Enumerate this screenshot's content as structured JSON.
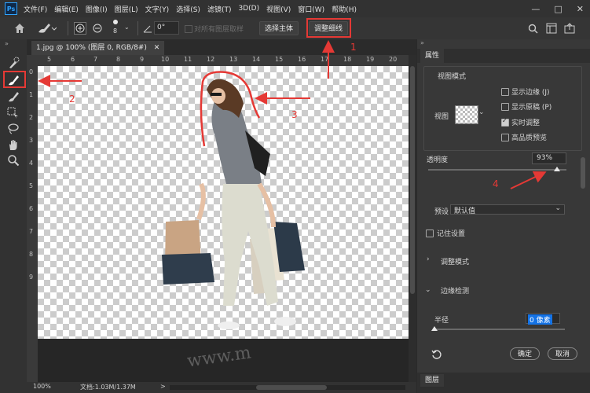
{
  "app": {
    "logo_text": "Ps"
  },
  "menu": [
    "文件(F)",
    "编辑(E)",
    "图像(I)",
    "图层(L)",
    "文字(Y)",
    "选择(S)",
    "滤镜(T)",
    "3D(D)",
    "视图(V)",
    "窗口(W)",
    "帮助(H)"
  ],
  "window_controls": {
    "minimize": "—",
    "maximize": "□",
    "close": "✕"
  },
  "options": {
    "brush_size": "8",
    "angle": "0°",
    "sample_all_layers": "对所有图层取样",
    "select_subject": "选择主体",
    "refine_edge": "调整细线"
  },
  "document": {
    "tab_title": "1.jpg @ 100% (图层 0, RGB/8#)",
    "ruler_top": [
      "5",
      "6",
      "7",
      "8",
      "9",
      "10",
      "11",
      "12",
      "13",
      "14",
      "15",
      "16",
      "17",
      "18",
      "19",
      "20"
    ],
    "ruler_left": [
      "0",
      "1",
      "2",
      "3",
      "4",
      "5",
      "6",
      "7",
      "8",
      "9"
    ],
    "watermark": "www.m"
  },
  "status": {
    "zoom": "100%",
    "doc_info": "文档:1.03M/1.37M",
    "arrow": ">"
  },
  "panel": {
    "tab": "属性",
    "view_mode_title": "视图模式",
    "view_label": "视图",
    "show_edge": "显示边缘 (J)",
    "show_original": "显示原稿 (P)",
    "realtime": "实时调整",
    "high_quality": "高品质预览",
    "opacity_label": "透明度",
    "opacity_value": "93%",
    "opacity_fraction": 0.93,
    "preset_label": "预设",
    "preset_value": "默认值",
    "remember": "记住设置",
    "adjust_mode": "调整模式",
    "edge_detect": "边缘检测",
    "radius_label": "半径",
    "radius_value": "0 像素",
    "ok": "确定",
    "cancel": "取消",
    "layers_tab": "图层"
  },
  "annotations": {
    "n1": "1",
    "n2": "2",
    "n3": "3",
    "n4": "4"
  },
  "colors": {
    "annotation": "#e53935",
    "accent": "#1473e6",
    "panel_bg": "#383838"
  }
}
